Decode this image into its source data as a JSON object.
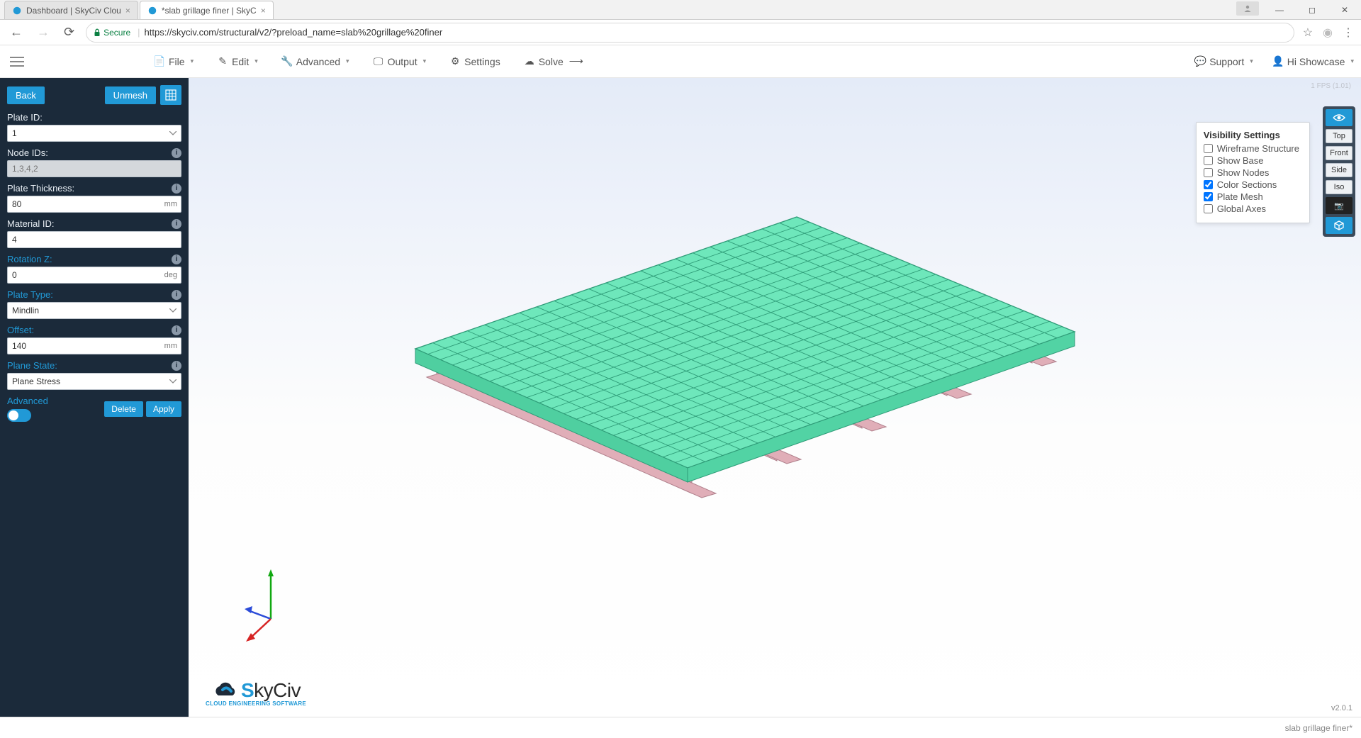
{
  "browser": {
    "tabs": [
      {
        "title": "Dashboard | SkyCiv Clou"
      },
      {
        "title": "*slab grillage finer | SkyC"
      }
    ],
    "url": "https://skyciv.com/structural/v2/?preload_name=slab%20grillage%20finer",
    "secure_label": "Secure"
  },
  "menu": {
    "file": "File",
    "edit": "Edit",
    "advanced": "Advanced",
    "output": "Output",
    "settings": "Settings",
    "solve": "Solve",
    "support": "Support",
    "user": "Hi Showcase"
  },
  "sidebar": {
    "back": "Back",
    "unmesh": "Unmesh",
    "plate_id": {
      "label": "Plate ID:",
      "value": "1"
    },
    "node_ids": {
      "label": "Node IDs:",
      "value": "1,3,4,2"
    },
    "thickness": {
      "label": "Plate Thickness:",
      "value": "80",
      "unit": "mm"
    },
    "material": {
      "label": "Material ID:",
      "value": "4"
    },
    "rotz": {
      "label": "Rotation Z:",
      "value": "0",
      "unit": "deg"
    },
    "type": {
      "label": "Plate Type:",
      "value": "Mindlin"
    },
    "offset": {
      "label": "Offset:",
      "value": "140",
      "unit": "mm"
    },
    "state": {
      "label": "Plane State:",
      "value": "Plane Stress"
    },
    "advanced": "Advanced",
    "delete": "Delete",
    "apply": "Apply"
  },
  "visibility": {
    "title": "Visibility Settings",
    "wireframe": "Wireframe Structure",
    "base": "Show Base",
    "nodes": "Show Nodes",
    "sections": "Color Sections",
    "mesh": "Plate Mesh",
    "axes": "Global Axes"
  },
  "viewbtns": {
    "top": "Top",
    "front": "Front",
    "side": "Side",
    "iso": "Iso"
  },
  "fps": "1 FPS (1.01)",
  "version": "v2.0.1",
  "filename": "slab grillage finer*",
  "logo": {
    "name": "SkyCiv",
    "sub": "CLOUD ENGINEERING SOFTWARE"
  }
}
